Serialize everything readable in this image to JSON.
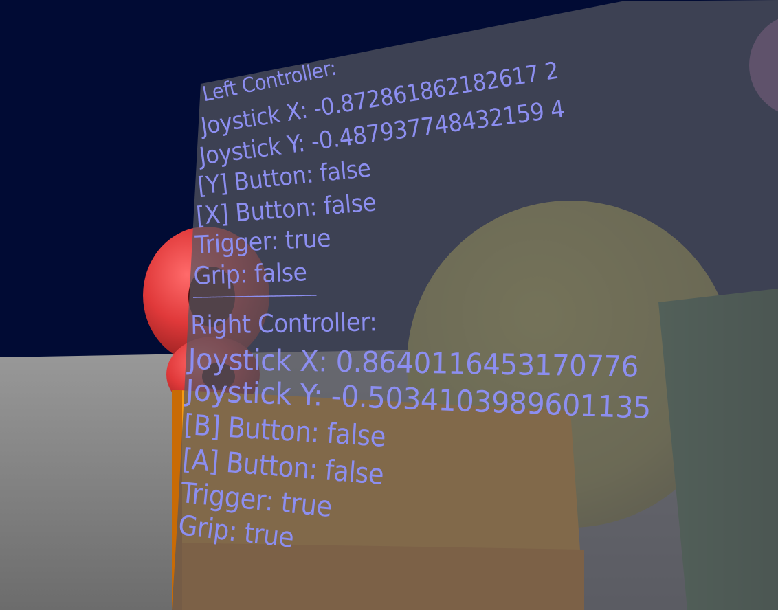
{
  "hud": {
    "left_controller": {
      "heading": "Left Controller:",
      "joystick_x": "Joystick X: -0.872861862182617 2",
      "joystick_y": "Joystick Y: -0.487937748432159 4",
      "y_button": "[Y] Button: false",
      "x_button": "[X] Button: false",
      "trigger": "Trigger: true",
      "grip": "Grip: false"
    },
    "divider": "------------------------------------------",
    "right_controller": {
      "heading": "Right Controller:",
      "joystick_x": "Joystick X: 0.8640116453170776",
      "joystick_y": "Joystick Y: -0.5034103989601135",
      "b_button": "[B] Button: false",
      "a_button": "[A] Button: false",
      "trigger": "Trigger: true",
      "grip": "Grip: true"
    }
  },
  "colors": {
    "sky": "#010b34",
    "floor": "#8a8a8a",
    "panel": "#4e4f55",
    "text": "#8c8ef0",
    "torus": "#e0393a",
    "sphere_yellow": "#a39c3c",
    "cylinder_green": "#3e5c3c",
    "box_orange": "#f28a10",
    "sphere_purple": "#7a4a88"
  }
}
